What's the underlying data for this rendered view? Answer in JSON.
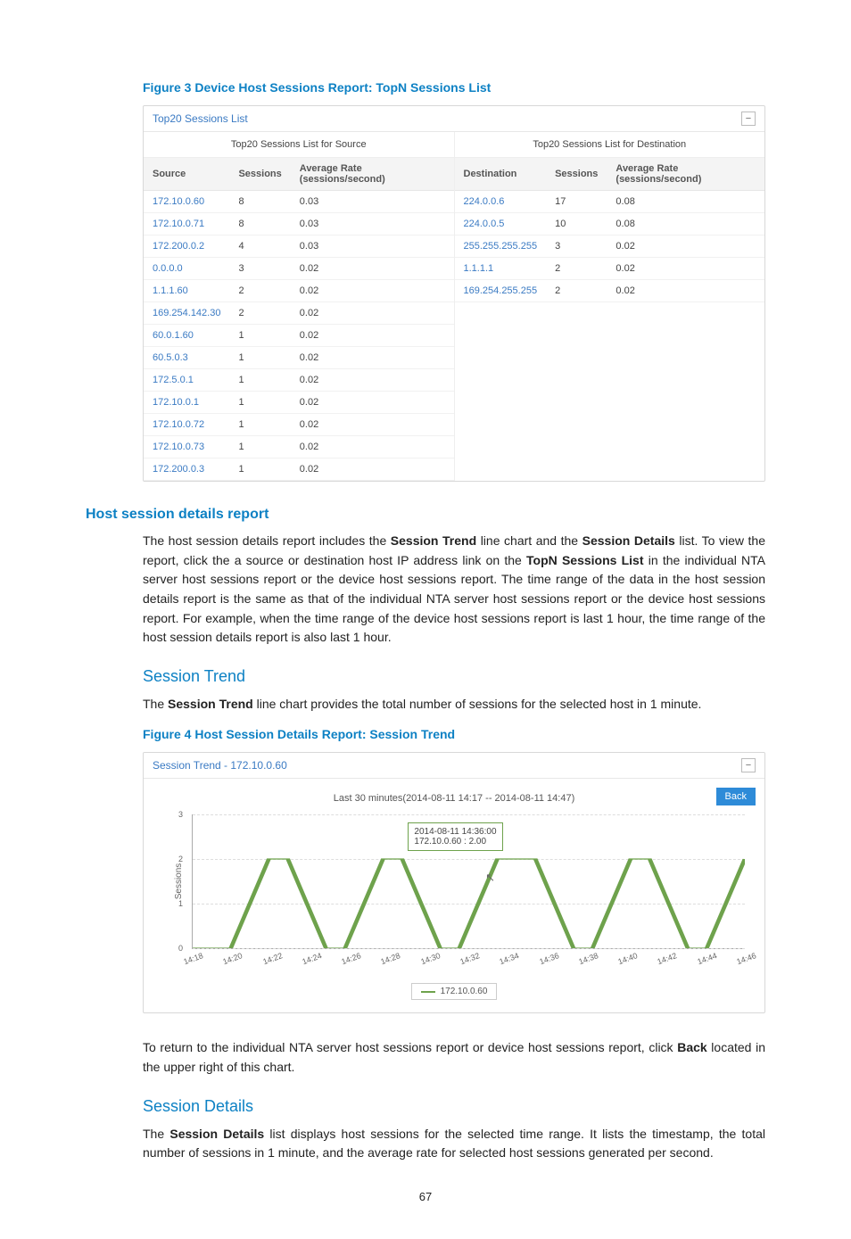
{
  "figure3": {
    "caption": "Figure 3 Device Host Sessions Report: TopN Sessions List",
    "panel_title": "Top20 Sessions List",
    "collapse_glyph": "−",
    "source_table": {
      "title": "Top20 Sessions List for Source",
      "headers": {
        "col1": "Source",
        "col2": "Sessions",
        "col3": "Average Rate (sessions/second)"
      },
      "rows": [
        {
          "ip": "172.10.0.60",
          "sessions": "8",
          "rate": "0.03"
        },
        {
          "ip": "172.10.0.71",
          "sessions": "8",
          "rate": "0.03"
        },
        {
          "ip": "172.200.0.2",
          "sessions": "4",
          "rate": "0.03"
        },
        {
          "ip": "0.0.0.0",
          "sessions": "3",
          "rate": "0.02"
        },
        {
          "ip": "1.1.1.60",
          "sessions": "2",
          "rate": "0.02"
        },
        {
          "ip": "169.254.142.30",
          "sessions": "2",
          "rate": "0.02"
        },
        {
          "ip": "60.0.1.60",
          "sessions": "1",
          "rate": "0.02"
        },
        {
          "ip": "60.5.0.3",
          "sessions": "1",
          "rate": "0.02"
        },
        {
          "ip": "172.5.0.1",
          "sessions": "1",
          "rate": "0.02"
        },
        {
          "ip": "172.10.0.1",
          "sessions": "1",
          "rate": "0.02"
        },
        {
          "ip": "172.10.0.72",
          "sessions": "1",
          "rate": "0.02"
        },
        {
          "ip": "172.10.0.73",
          "sessions": "1",
          "rate": "0.02"
        },
        {
          "ip": "172.200.0.3",
          "sessions": "1",
          "rate": "0.02"
        }
      ]
    },
    "dest_table": {
      "title": "Top20 Sessions List for Destination",
      "headers": {
        "col1": "Destination",
        "col2": "Sessions",
        "col3": "Average Rate (sessions/second)"
      },
      "rows": [
        {
          "ip": "224.0.0.6",
          "sessions": "17",
          "rate": "0.08"
        },
        {
          "ip": "224.0.0.5",
          "sessions": "10",
          "rate": "0.08"
        },
        {
          "ip": "255.255.255.255",
          "sessions": "3",
          "rate": "0.02"
        },
        {
          "ip": "1.1.1.1",
          "sessions": "2",
          "rate": "0.02"
        },
        {
          "ip": "169.254.255.255",
          "sessions": "2",
          "rate": "0.02"
        }
      ]
    }
  },
  "section1": {
    "heading": "Host session details report",
    "para1_pre": "The host session details report includes the ",
    "para1_b1": "Session Trend",
    "para1_mid1": " line chart and the ",
    "para1_b2": "Session Details",
    "para1_mid2": " list. To view the report, click the a source or destination host IP address link on the ",
    "para1_b3": "TopN Sessions List",
    "para1_post": " in the individual NTA server host sessions report or the device host sessions report. The time range of the data in the host session details report is the same as that of the individual NTA server host sessions report or the device host sessions report. For example, when the time range of the device host sessions report is last 1 hour, the time range of the host session details report is also last 1 hour."
  },
  "section2": {
    "heading": "Session Trend",
    "para_pre": "The ",
    "para_b": "Session Trend",
    "para_post": " line chart provides the total number of sessions for the selected host in 1 minute."
  },
  "figure4": {
    "caption": "Figure 4 Host Session Details Report: Session Trend",
    "panel_title": "Session Trend - 172.10.0.60",
    "collapse_glyph": "−",
    "range_text": "Last 30 minutes(2014-08-11 14:17 -- 2014-08-11 14:47)",
    "back_label": "Back",
    "ylabel": "Sessions",
    "legend_label": "172.10.0.60",
    "tooltip_line1": "2014-08-11 14:36:00",
    "tooltip_line2": "172.10.0.60 : 2.00",
    "yticks": [
      "0",
      "1",
      "2",
      "3"
    ],
    "xticks": [
      "14:18",
      "14:20",
      "14:22",
      "14:24",
      "14:26",
      "14:28",
      "14:30",
      "14:32",
      "14:34",
      "14:36",
      "14:38",
      "14:40",
      "14:42",
      "14:44",
      "14:46"
    ]
  },
  "chart_data": {
    "type": "line",
    "title": "Session Trend - 172.10.0.60",
    "xlabel": "",
    "ylabel": "Sessions",
    "ylim": [
      0,
      3
    ],
    "x": [
      "14:18",
      "14:19",
      "14:20",
      "14:21",
      "14:22",
      "14:23",
      "14:24",
      "14:25",
      "14:26",
      "14:27",
      "14:28",
      "14:29",
      "14:30",
      "14:31",
      "14:32",
      "14:33",
      "14:34",
      "14:35",
      "14:36",
      "14:37",
      "14:38",
      "14:39",
      "14:40",
      "14:41",
      "14:42",
      "14:43",
      "14:44",
      "14:45",
      "14:46",
      "14:47"
    ],
    "series": [
      {
        "name": "172.10.0.60",
        "values": [
          0,
          0,
          0,
          1,
          2,
          2,
          1,
          0,
          0,
          1,
          2,
          2,
          1,
          0,
          0,
          1,
          2,
          2,
          2,
          1,
          0,
          0,
          1,
          2,
          2,
          1,
          0,
          0,
          1,
          2
        ]
      }
    ],
    "annotations": [
      {
        "x": "14:36",
        "text": "2014-08-11 14:36:00 172.10.0.60 : 2.00"
      }
    ]
  },
  "section3": {
    "para_pre": "To return to the individual NTA server host sessions report or device host sessions report, click ",
    "para_b": "Back",
    "para_post": " located in the upper right of this chart."
  },
  "section4": {
    "heading": "Session Details",
    "para_pre": "The ",
    "para_b": "Session Details",
    "para_post": " list displays host sessions for the selected time range. It lists the timestamp, the total number of sessions in 1 minute, and the average rate for selected host sessions generated per second."
  },
  "page_number": "67"
}
